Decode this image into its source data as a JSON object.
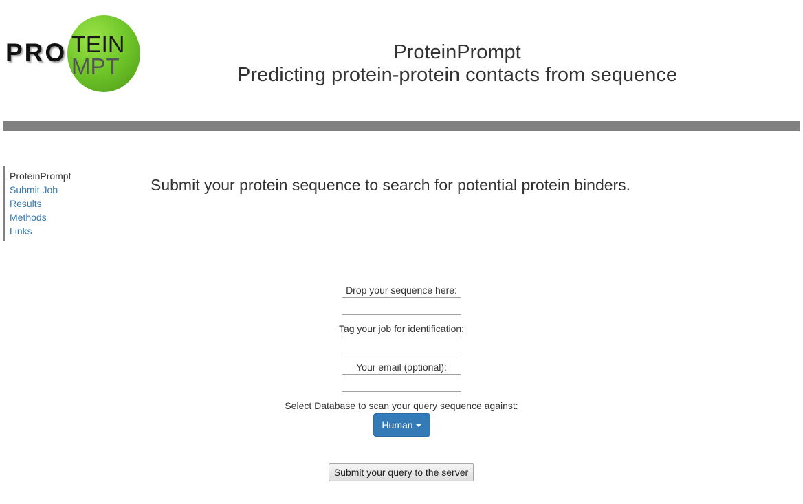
{
  "header": {
    "logo": {
      "text_left": "PRO",
      "text_top": "TEIN",
      "text_bottom": "MPT",
      "circle_color": "#72c82a"
    },
    "title": "ProteinPrompt",
    "subtitle": "Predicting protein-protein contacts from sequence"
  },
  "sidebar": {
    "items": [
      {
        "label": "ProteinPrompt",
        "current": true
      },
      {
        "label": "Submit Job",
        "current": false
      },
      {
        "label": "Results",
        "current": false
      },
      {
        "label": "Methods",
        "current": false
      },
      {
        "label": "Links",
        "current": false
      }
    ]
  },
  "main": {
    "headline": "Submit your protein sequence to search for potential protein binders.",
    "form": {
      "sequence_label": "Drop your sequence here:",
      "sequence_value": "",
      "tag_label": "Tag your job for identification:",
      "tag_value": "",
      "email_label": "Your email (optional):",
      "email_value": "",
      "database_label": "Select Database to scan your query sequence against:",
      "database_selected": "Human",
      "submit_label": "Submit your query to the server"
    }
  },
  "colors": {
    "link": "#337ab7",
    "divider": "#808080",
    "primary_button": "#337ab7"
  }
}
